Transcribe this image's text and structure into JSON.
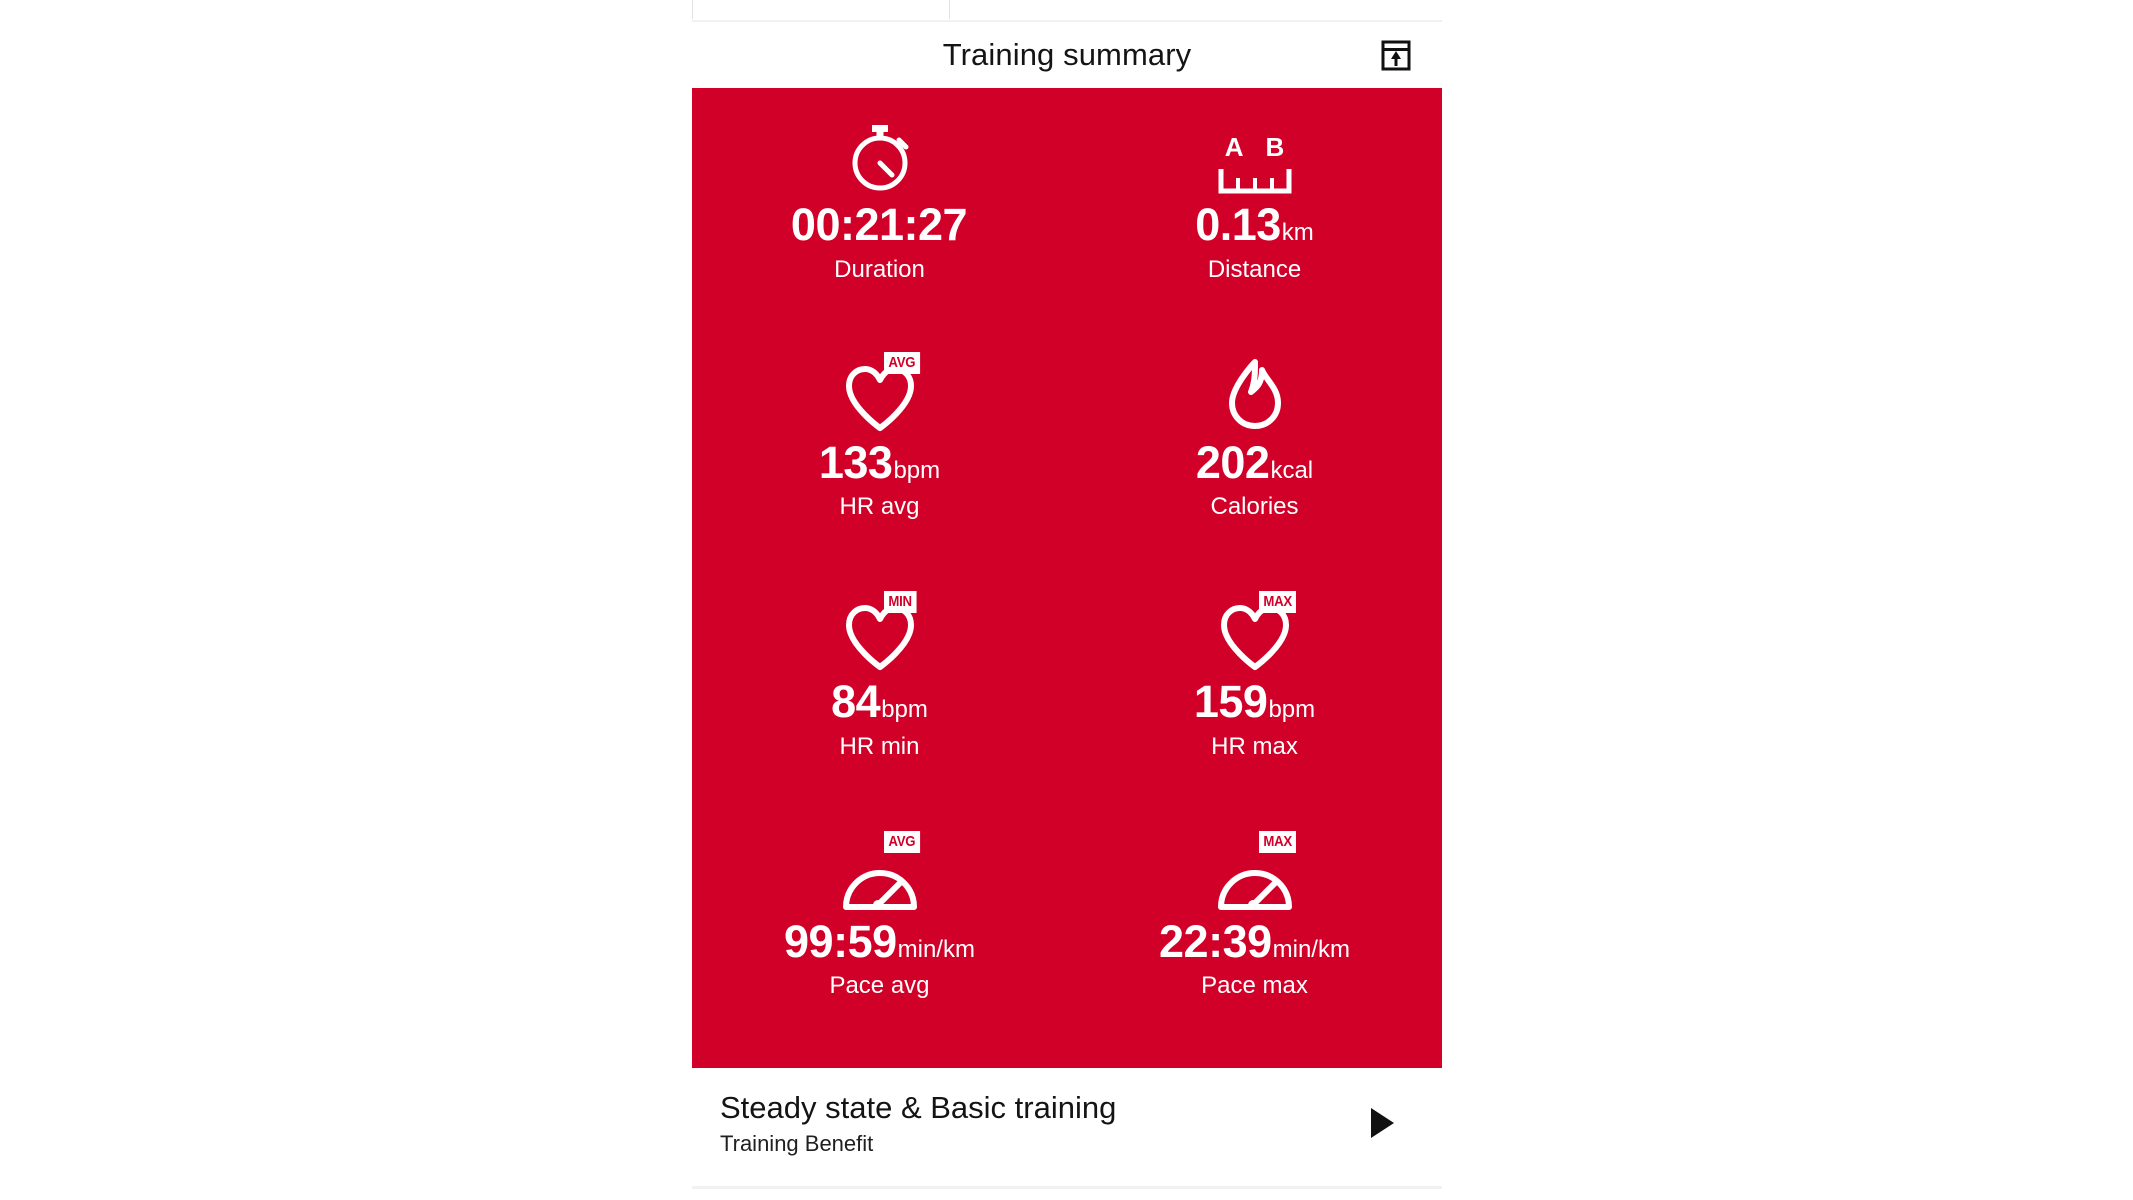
{
  "header": {
    "title": "Training summary",
    "share_icon": "export-icon"
  },
  "colors": {
    "panel_red": "#d10028",
    "text_dark": "#141414",
    "white": "#ffffff"
  },
  "summary": {
    "metrics": [
      {
        "icon": "stopwatch-icon",
        "badge": "",
        "value": "00:21:27",
        "unit": "",
        "label": "Duration"
      },
      {
        "icon": "distance-ruler-icon",
        "badge": "",
        "value": "0.13",
        "unit": "km",
        "label": "Distance",
        "point_a": "A",
        "point_b": "B"
      },
      {
        "icon": "heart-icon",
        "badge": "AVG",
        "value": "133",
        "unit": "bpm",
        "label": "HR avg"
      },
      {
        "icon": "flame-icon",
        "badge": "",
        "value": "202",
        "unit": "kcal",
        "label": "Calories"
      },
      {
        "icon": "heart-icon",
        "badge": "MIN",
        "value": "84",
        "unit": "bpm",
        "label": "HR min"
      },
      {
        "icon": "heart-icon",
        "badge": "MAX",
        "value": "159",
        "unit": "bpm",
        "label": "HR max"
      },
      {
        "icon": "speedometer-icon",
        "badge": "AVG",
        "value": "99:59",
        "unit": "min/km",
        "label": "Pace avg"
      },
      {
        "icon": "speedometer-icon",
        "badge": "MAX",
        "value": "22:39",
        "unit": "min/km",
        "label": "Pace max"
      }
    ]
  },
  "benefit": {
    "title": "Steady state & Basic training",
    "subtitle": "Training Benefit",
    "action_icon": "play-icon"
  }
}
